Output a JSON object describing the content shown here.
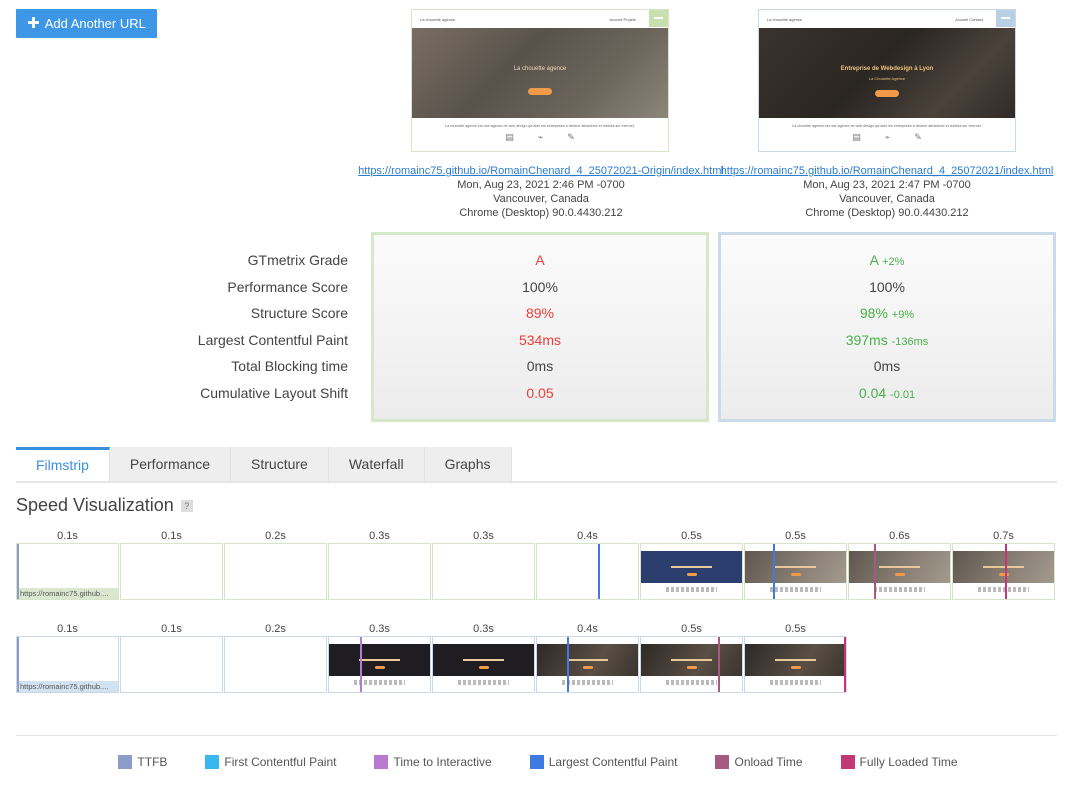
{
  "toolbar": {
    "add_url_label": "Add Another URL"
  },
  "reports": [
    {
      "url": "https://romainc75.github.io/RomainChenard_4_25072021-Origin/index.html",
      "date": "Mon, Aug 23, 2021 2:46 PM -0700",
      "location": "Vancouver, Canada",
      "browser": "Chrome (Desktop) 90.0.4430.212",
      "thumb": {
        "brand": "La chouette agence",
        "nav": "Accueil   Projets",
        "hero_title": "La chouette agence",
        "hero_sub": "",
        "body_text": "La chouette agence est une agence de web design qui aide les entreprises à devenir attractives et visibles sur Internet."
      },
      "grades": {
        "gtmetrix_grade": "A",
        "performance": "100%",
        "structure": "89%",
        "lcp": "534ms",
        "tbt": "0ms",
        "cls": "0.05"
      }
    },
    {
      "url": "https://romainc75.github.io/RomainChenard_4_25072021/index.html",
      "date": "Mon, Aug 23, 2021 2:47 PM -0700",
      "location": "Vancouver, Canada",
      "browser": "Chrome (Desktop) 90.0.4430.212",
      "thumb": {
        "brand": "La chouette agence",
        "nav": "Accueil   Contact",
        "hero_title": "Entreprise de Webdesign à Lyon",
        "hero_sub": "La Chouette Agence",
        "body_text": "La chouette agence est une agence de web design qui aide les entreprises à devenir attractives et visibles sur Internet."
      },
      "grades": {
        "gtmetrix_grade": "A",
        "gtmetrix_delta": "+2%",
        "performance": "100%",
        "structure": "98%",
        "structure_delta": "+9%",
        "lcp": "397ms",
        "lcp_delta": "-136ms",
        "tbt": "0ms",
        "cls": "0.04",
        "cls_delta": "-0.01"
      }
    }
  ],
  "metric_labels": [
    "GTmetrix Grade",
    "Performance Score",
    "Structure Score",
    "Largest Contentful Paint",
    "Total Blocking time",
    "Cumulative Layout Shift"
  ],
  "tabs": [
    "Filmstrip",
    "Performance",
    "Structure",
    "Waterfall",
    "Graphs"
  ],
  "active_tab": "Filmstrip",
  "speed": {
    "title": "Speed Visualization",
    "help": "?",
    "strip1_times": [
      "0.1s",
      "0.1s",
      "0.2s",
      "0.3s",
      "0.3s",
      "0.4s",
      "0.5s",
      "0.5s",
      "0.6s",
      "0.7s"
    ],
    "strip2_times": [
      "0.1s",
      "0.1s",
      "0.2s",
      "0.3s",
      "0.3s",
      "0.4s",
      "0.5s",
      "0.5s"
    ],
    "frame_url": "https://romainc75.github...."
  },
  "legend": [
    {
      "label": "TTFB",
      "color": "#8e9cc8"
    },
    {
      "label": "First Contentful Paint",
      "color": "#39b7ee"
    },
    {
      "label": "Time to Interactive",
      "color": "#b87ad0"
    },
    {
      "label": "Largest Contentful Paint",
      "color": "#3f7ae0"
    },
    {
      "label": "Onload Time",
      "color": "#a65a82"
    },
    {
      "label": "Fully Loaded Time",
      "color": "#c23872"
    }
  ]
}
